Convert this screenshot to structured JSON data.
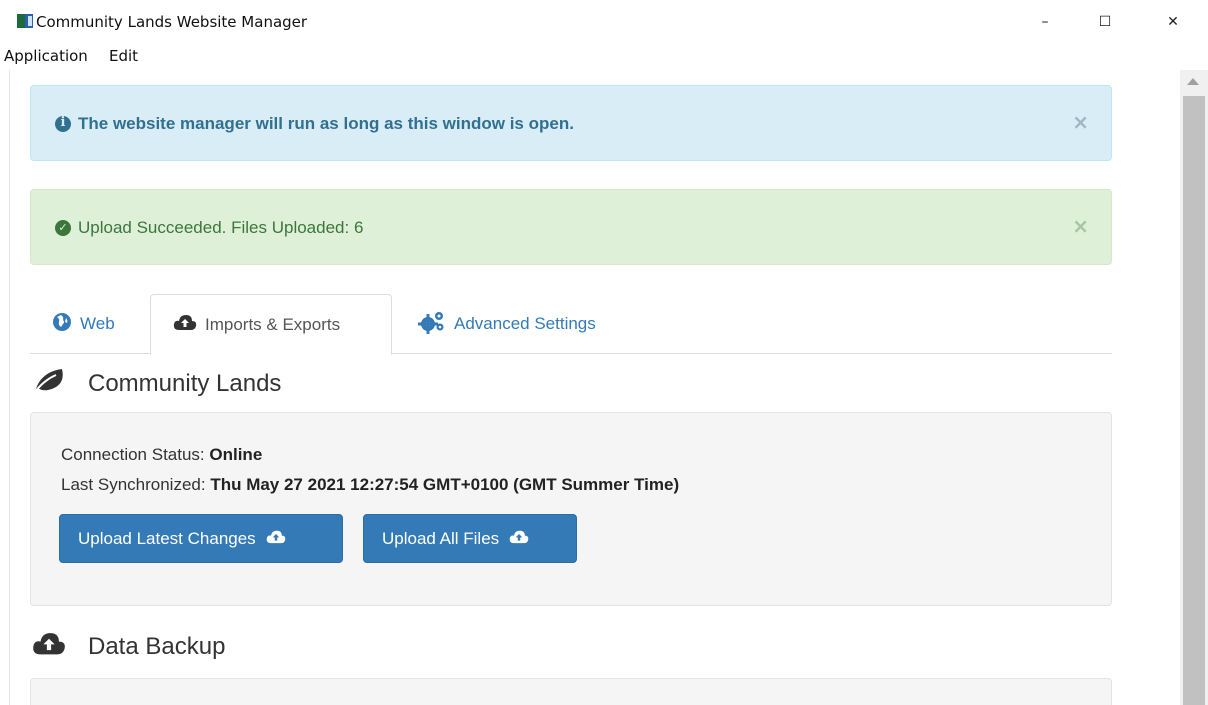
{
  "window": {
    "title": "Community Lands Website Manager",
    "minimize_glyph": "–",
    "maximize_glyph": "☐",
    "close_glyph": "✕"
  },
  "menu": {
    "items": [
      "Application",
      "Edit"
    ]
  },
  "alerts": {
    "info": {
      "text": "The website manager will run as long as this window is open.",
      "icon": "info-circle-icon",
      "close": "×"
    },
    "success": {
      "text": "Upload Succeeded. Files Uploaded: 6",
      "icon": "check-circle-icon",
      "close": "×"
    }
  },
  "tabs": [
    {
      "label": "Web",
      "icon": "globe-icon",
      "active": false
    },
    {
      "label": "Imports & Exports",
      "icon": "cloud-upload-icon",
      "active": true
    },
    {
      "label": "Advanced Settings",
      "icon": "cogs-icon",
      "active": false
    }
  ],
  "community_lands": {
    "title": "Community Lands",
    "icon": "leaf-icon",
    "connection_label": "Connection Status: ",
    "connection_value": "Online",
    "sync_label": "Last Synchronized: ",
    "sync_value": "Thu May 27 2021 12:27:54 GMT+0100 (GMT Summer Time)",
    "buttons": {
      "upload_latest": "Upload Latest Changes",
      "upload_all": "Upload All Files"
    }
  },
  "data_backup": {
    "title": "Data Backup",
    "icon": "cloud-upload-icon"
  },
  "colors": {
    "primary": "#337ab7",
    "info_bg": "#d9edf7",
    "info_text": "#31708f",
    "success_bg": "#dff0d8",
    "success_text": "#3c763d"
  }
}
